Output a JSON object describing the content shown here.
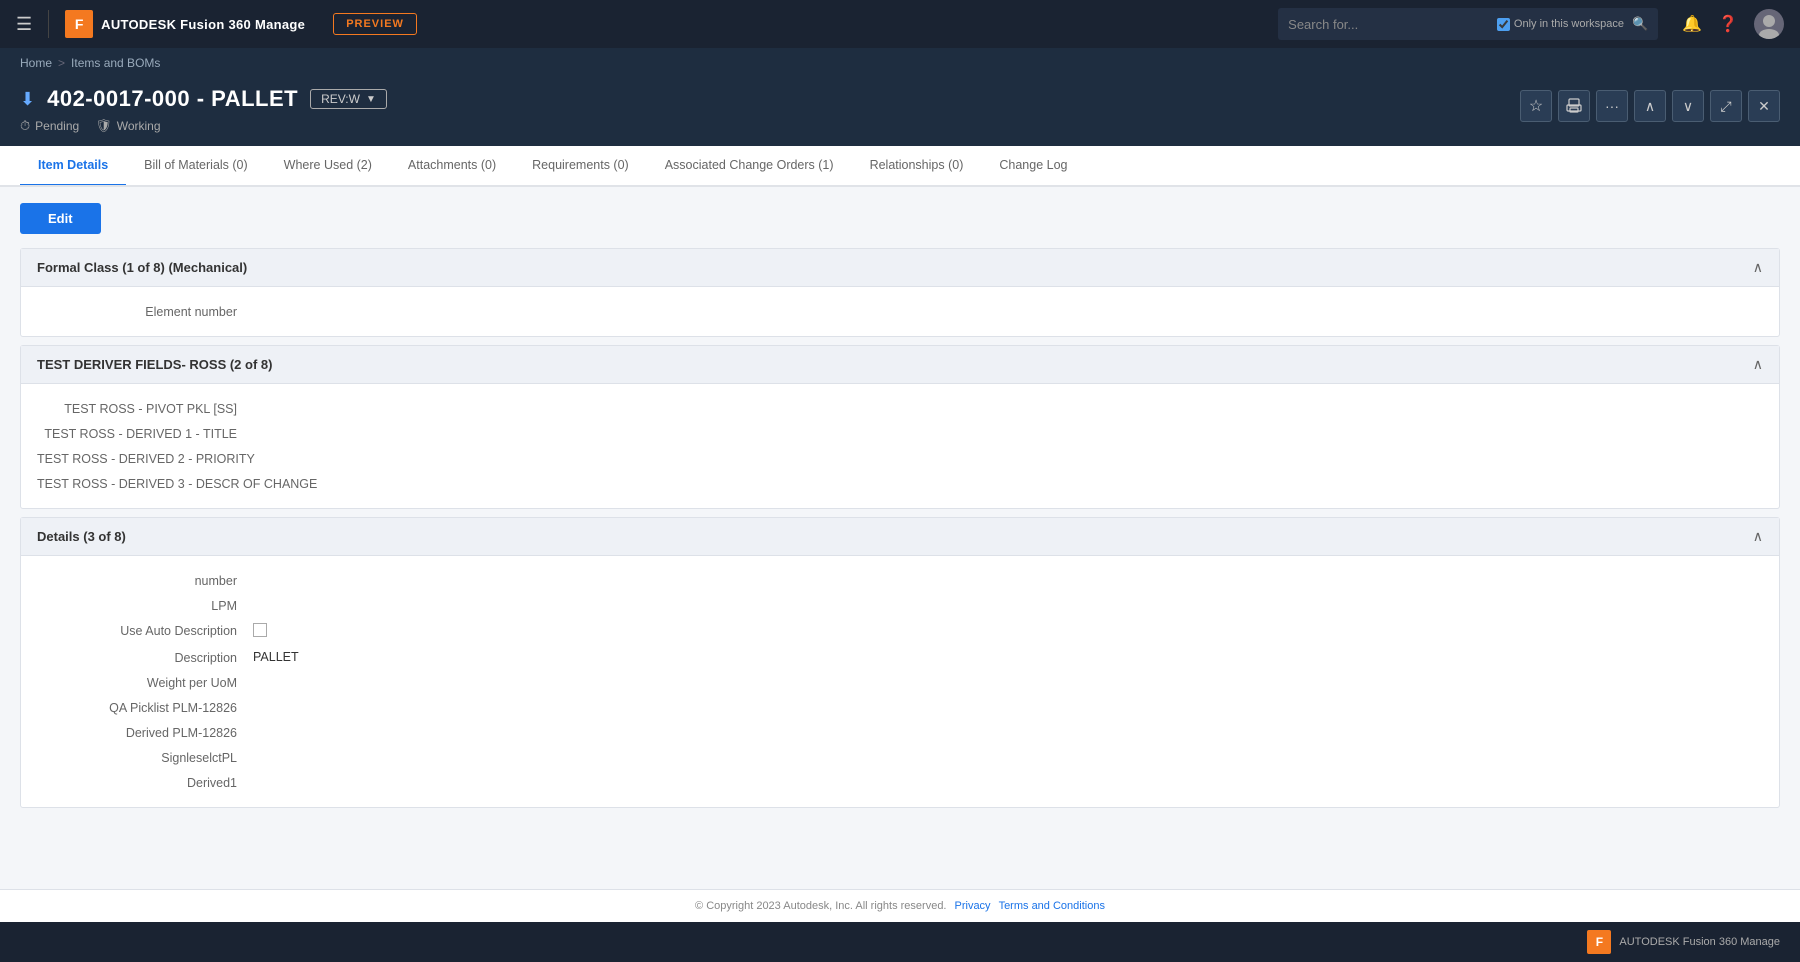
{
  "topnav": {
    "brand_letter": "F",
    "brand_name": "AUTODESK Fusion 360 Manage",
    "preview_label": "PREVIEW",
    "search_placeholder": "Search for...",
    "search_workspace_label": "Only in this workspace"
  },
  "breadcrumb": {
    "home": "Home",
    "separator": ">",
    "current": "Items and BOMs"
  },
  "item": {
    "title": "402-0017-000 - PALLET",
    "rev_label": "REV:W",
    "status_pending": "Pending",
    "status_working": "Working"
  },
  "tabs": [
    {
      "id": "item-details",
      "label": "Item Details",
      "active": true
    },
    {
      "id": "bom",
      "label": "Bill of Materials (0)"
    },
    {
      "id": "where-used",
      "label": "Where Used (2)"
    },
    {
      "id": "attachments",
      "label": "Attachments (0)"
    },
    {
      "id": "requirements",
      "label": "Requirements (0)"
    },
    {
      "id": "change-orders",
      "label": "Associated Change Orders (1)"
    },
    {
      "id": "relationships",
      "label": "Relationships (0)"
    },
    {
      "id": "change-log",
      "label": "Change Log"
    }
  ],
  "edit_button": "Edit",
  "sections": [
    {
      "id": "formal-class",
      "title": "Formal Class (1 of 8) (Mechanical)",
      "collapsed": false,
      "fields": [
        {
          "label": "Element number",
          "value": ""
        }
      ]
    },
    {
      "id": "test-deriver",
      "title": "TEST DERIVER FIELDS- ROSS (2 of 8)",
      "collapsed": false,
      "fields": [
        {
          "label": "TEST ROSS - PIVOT PKL [SS]",
          "value": ""
        },
        {
          "label": "TEST ROSS - DERIVED 1 - TITLE",
          "value": ""
        },
        {
          "label": "TEST ROSS - DERIVED 2 - PRIORITY",
          "value": ""
        },
        {
          "label": "TEST ROSS - DERIVED 3 - DESCR OF CHANGE",
          "value": ""
        }
      ]
    },
    {
      "id": "details",
      "title": "Details (3 of 8)",
      "collapsed": false,
      "fields": [
        {
          "label": "number",
          "value": ""
        },
        {
          "label": "LPM",
          "value": ""
        },
        {
          "label": "Use Auto Description",
          "value": "",
          "type": "checkbox"
        },
        {
          "label": "Description",
          "value": "PALLET"
        },
        {
          "label": "Weight per UoM",
          "value": ""
        },
        {
          "label": "QA Picklist PLM-12826",
          "value": ""
        },
        {
          "label": "Derived PLM-12826",
          "value": ""
        },
        {
          "label": "SignleselctPL",
          "value": ""
        },
        {
          "label": "Derived1",
          "value": ""
        }
      ]
    }
  ],
  "footer": {
    "copyright": "© Copyright 2023 Autodesk, Inc. All rights reserved.",
    "privacy_label": "Privacy",
    "terms_label": "Terms and Conditions"
  },
  "bottom_brand": {
    "letter": "F",
    "text": "AUTODESK Fusion 360 Manage"
  },
  "header_buttons": {
    "star": "☆",
    "print": "🖨",
    "more": "···",
    "up": "∧",
    "down": "∨",
    "expand": "⤢",
    "close": "✕"
  }
}
